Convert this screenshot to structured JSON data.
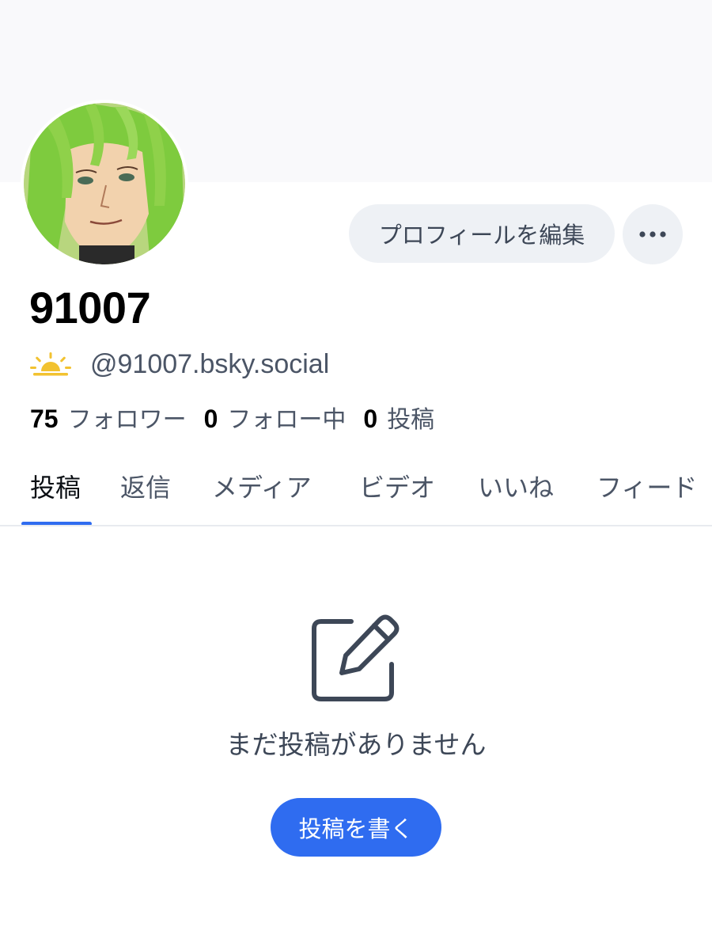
{
  "profile": {
    "display_name": "91007",
    "handle": "@91007.bsky.social",
    "avatar_icon": "avatar-illustration",
    "status_icon": "sunrise-icon"
  },
  "actions": {
    "edit_profile_label": "プロフィールを編集",
    "more_icon": "more-horizontal-icon"
  },
  "stats": [
    {
      "count": "75",
      "label": "フォロワー"
    },
    {
      "count": "0",
      "label": "フォロー中"
    },
    {
      "count": "0",
      "label": "投稿"
    }
  ],
  "tabs": [
    {
      "label": "投稿",
      "active": true
    },
    {
      "label": "返信",
      "active": false
    },
    {
      "label": "メディア",
      "active": false
    },
    {
      "label": "ビデオ",
      "active": false
    },
    {
      "label": "いいね",
      "active": false
    },
    {
      "label": "フィード",
      "active": false
    }
  ],
  "empty_state": {
    "icon": "compose-icon",
    "message": "まだ投稿がありません",
    "button_label": "投稿を書く"
  },
  "colors": {
    "accent": "#2f6cf0",
    "secondary_button": "#eef1f5",
    "muted_text": "#4b5566",
    "sun": "#f2c230"
  }
}
